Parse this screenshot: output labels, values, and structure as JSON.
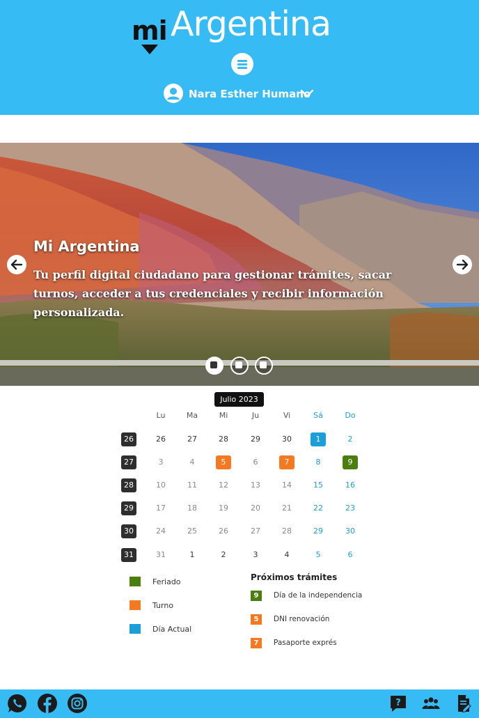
{
  "header": {
    "logo_mi": "mi",
    "logo_argentina": "Argentina",
    "user_name": "Nara Esther Humano"
  },
  "hero": {
    "title": "Mi Argentina",
    "text": "Tu perfil digital ciudadano para gestionar trámites, sacar turnos, acceder a tus credenciales y recibir información personalizada."
  },
  "calendar": {
    "month_label": "Julio 2023",
    "weekdays": [
      "Lu",
      "Ma",
      "Mi",
      "Ju",
      "Vi",
      "Sá",
      "Do"
    ],
    "weeks": [
      {
        "week": "26",
        "days": [
          "26",
          "27",
          "28",
          "29",
          "30",
          "1",
          "2"
        ]
      },
      {
        "week": "27",
        "days": [
          "3",
          "4",
          "5",
          "6",
          "7",
          "8",
          "9"
        ]
      },
      {
        "week": "28",
        "days": [
          "10",
          "11",
          "12",
          "13",
          "14",
          "15",
          "16"
        ]
      },
      {
        "week": "29",
        "days": [
          "17",
          "18",
          "19",
          "20",
          "21",
          "22",
          "23"
        ]
      },
      {
        "week": "30",
        "days": [
          "24",
          "25",
          "26",
          "27",
          "28",
          "29",
          "30"
        ]
      },
      {
        "week": "31",
        "days": [
          "31",
          "1",
          "2",
          "3",
          "4",
          "5",
          "6"
        ]
      }
    ]
  },
  "legend": {
    "feriado": "Feriado",
    "turno": "Turno",
    "dia_actual": "Día Actual"
  },
  "proximos": {
    "title": "Próximos trámites",
    "items": [
      {
        "day": "9",
        "label": "Día de la independencia"
      },
      {
        "day": "5",
        "label": "DNI renovación"
      },
      {
        "day": "7",
        "label": "Pasaporte exprés"
      }
    ]
  },
  "colors": {
    "brand_blue": "#37bbf4",
    "feriado": "#4b7d0f",
    "turno": "#f47920",
    "dia_actual": "#1a9fd8",
    "week_badge": "#2e2e2e"
  },
  "icons": {
    "footer_left": [
      "whatsapp-icon",
      "facebook-icon",
      "instagram-icon"
    ],
    "footer_right": [
      "help-icon",
      "community-icon",
      "document-edit-icon"
    ]
  }
}
